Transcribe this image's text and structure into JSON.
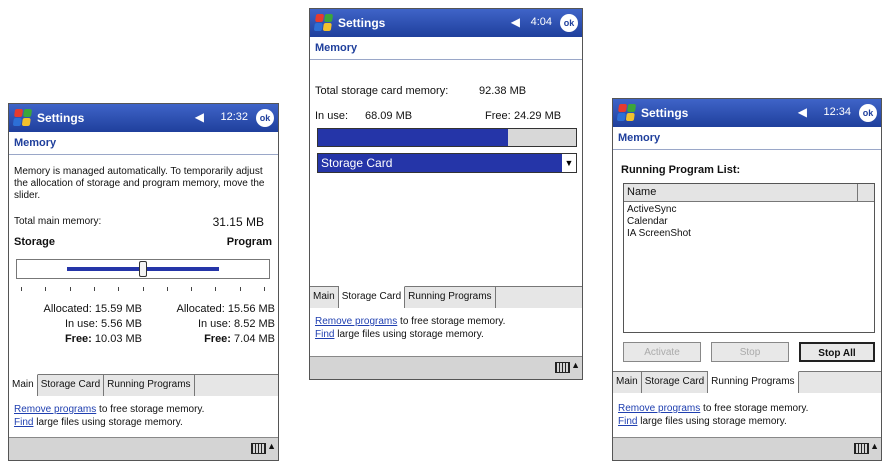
{
  "shared": {
    "app_title": "Settings",
    "section_title": "Memory",
    "ok_label": "ok",
    "speaker_symbol": "◀",
    "tabs": [
      "Main",
      "Storage Card",
      "Running Programs"
    ],
    "link_remove": "Remove programs",
    "link_remove_rest": " to free storage memory.",
    "link_find": "Find",
    "link_find_rest": " large files using storage memory.",
    "colors": {
      "titlebar": "#2a4bb0",
      "accent": "#2535a8",
      "logo": [
        "#e63b2e",
        "#3ca63a",
        "#2d6fd6",
        "#f2c12e"
      ]
    }
  },
  "screen1": {
    "time": "12:32",
    "intro": "Memory is managed automatically. To temporarily adjust the allocation of storage and program memory, move the slider.",
    "total_label": "Total main memory:",
    "total_value": "31.15 MB",
    "storage_label": "Storage",
    "program_label": "Program",
    "slider_fraction": 0.5,
    "left": {
      "allocated_label": "Allocated:",
      "allocated": "15.59 MB",
      "inuse_label": "In use:",
      "inuse": "5.56 MB",
      "free_label": "Free:",
      "free": "10.03 MB"
    },
    "right": {
      "allocated_label": "Allocated:",
      "allocated": "15.56 MB",
      "inuse_label": "In use:",
      "inuse": "8.52 MB",
      "free_label": "Free:",
      "free": "7.04 MB"
    }
  },
  "screen2": {
    "time": "4:04",
    "total_label": "Total storage card memory:",
    "total_value": "92.38 MB",
    "inuse_label": "In use:",
    "inuse_value": "68.09 MB",
    "free_label": "Free:",
    "free_value": "24.29 MB",
    "usage_fraction": 0.737,
    "dropdown_value": "Storage Card"
  },
  "screen3": {
    "time": "12:34",
    "list_title": "Running Program List:",
    "column_header": "Name",
    "programs": [
      "ActiveSync",
      "Calendar",
      "IA ScreenShot"
    ],
    "buttons": {
      "activate": "Activate",
      "stop": "Stop",
      "stop_all": "Stop All"
    }
  }
}
